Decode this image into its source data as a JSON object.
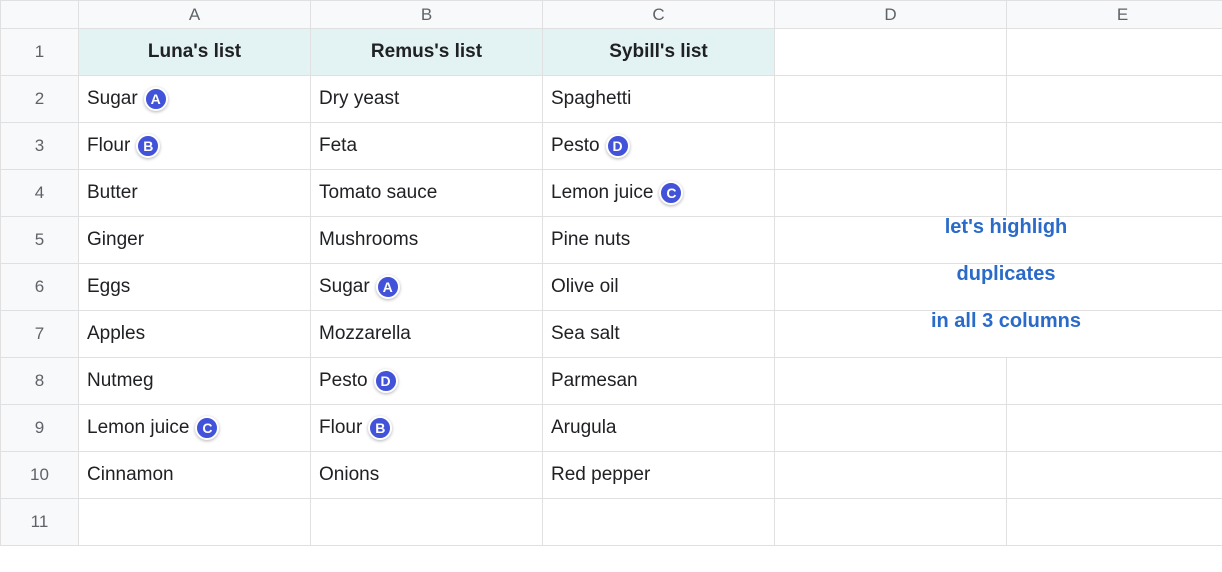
{
  "columns": [
    "A",
    "B",
    "C",
    "D",
    "E"
  ],
  "rowCount": 11,
  "headers": {
    "A": "Luna's list",
    "B": "Remus's list",
    "C": "Sybill's list"
  },
  "data": {
    "A": [
      {
        "text": "Sugar",
        "marker": "A"
      },
      {
        "text": "Flour",
        "marker": "B"
      },
      {
        "text": "Butter"
      },
      {
        "text": "Ginger"
      },
      {
        "text": "Eggs"
      },
      {
        "text": "Apples"
      },
      {
        "text": "Nutmeg"
      },
      {
        "text": "Lemon juice",
        "marker": "C"
      },
      {
        "text": "Cinnamon"
      }
    ],
    "B": [
      {
        "text": "Dry yeast"
      },
      {
        "text": "Feta"
      },
      {
        "text": "Tomato sauce"
      },
      {
        "text": "Mushrooms"
      },
      {
        "text": "Sugar",
        "marker": "A"
      },
      {
        "text": "Mozzarella"
      },
      {
        "text": "Pesto",
        "marker": "D"
      },
      {
        "text": "Flour",
        "marker": "B"
      },
      {
        "text": "Onions"
      }
    ],
    "C": [
      {
        "text": "Spaghetti"
      },
      {
        "text": "Pesto",
        "marker": "D"
      },
      {
        "text": "Lemon juice",
        "marker": "C"
      },
      {
        "text": "Pine nuts"
      },
      {
        "text": "Olive oil"
      },
      {
        "text": "Sea salt"
      },
      {
        "text": "Parmesan"
      },
      {
        "text": "Arugula"
      },
      {
        "text": "Red pepper"
      }
    ]
  },
  "annotation": {
    "line1": "let's highligh",
    "line2": "duplicates",
    "line3": "in all 3 columns"
  }
}
